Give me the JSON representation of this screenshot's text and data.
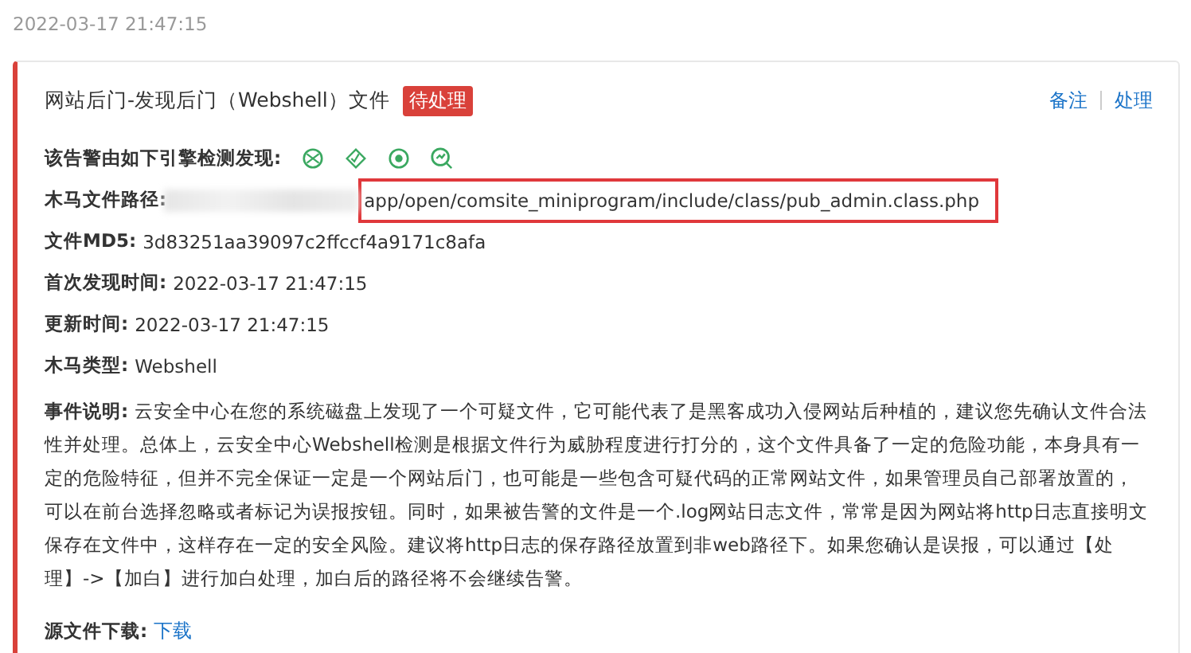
{
  "timestamp": "2022-03-17 21:47:15",
  "alert": {
    "title": "网站后门-发现后门（Webshell）文件",
    "status": "待处理",
    "actions": [
      "备注",
      "处理"
    ],
    "engines_label": "该告警由如下引擎检测发现:",
    "path": {
      "label": "木马文件路径:",
      "value": "app/open/comsite_miniprogram/include/class/pub_admin.class.php",
      "highlighted": true
    },
    "fields": [
      {
        "label": "文件MD5:",
        "value": "3d83251aa39097c2ffccf4a9171c8afa"
      },
      {
        "label": "首次发现时间:",
        "value": "2022-03-17 21:47:15"
      },
      {
        "label": "更新时间:",
        "value": "2022-03-17 21:47:15"
      },
      {
        "label": "木马类型:",
        "value": "Webshell"
      }
    ],
    "description": "**事件说明:** 云安全中心在您的系统磁盘上发现了一个可疑文件，它可能代表了是黑客成功入侵网站后种植的，建议您先确认文件合法性并处理。总体上，云安全中心Webshell检测是根据文件行为威胁程度进行打分的，这个文件具备了一定的危险功能，本身具有一定的危险特征，但并不完全保证一定是一个网站后门，也可能是一些包含可疑代码的正常网站文件，如果管理员自己部署放置的，可以在前台选择忽略或者标记为误报按钮。同时，如果被告警的文件是一个.log网站日志文件，常常是因为网站将http日志直接明文保存在文件中，这样存在一定的安全风险。建议将http日志的保存路径放置到非web路径下。如果您确认是误报，可以通过【处理】->【加白】进行加白处理，加白后的路径将不会继续告警。",
    "download": {
      "label": "源文件下载:",
      "link": "下载"
    }
  }
}
